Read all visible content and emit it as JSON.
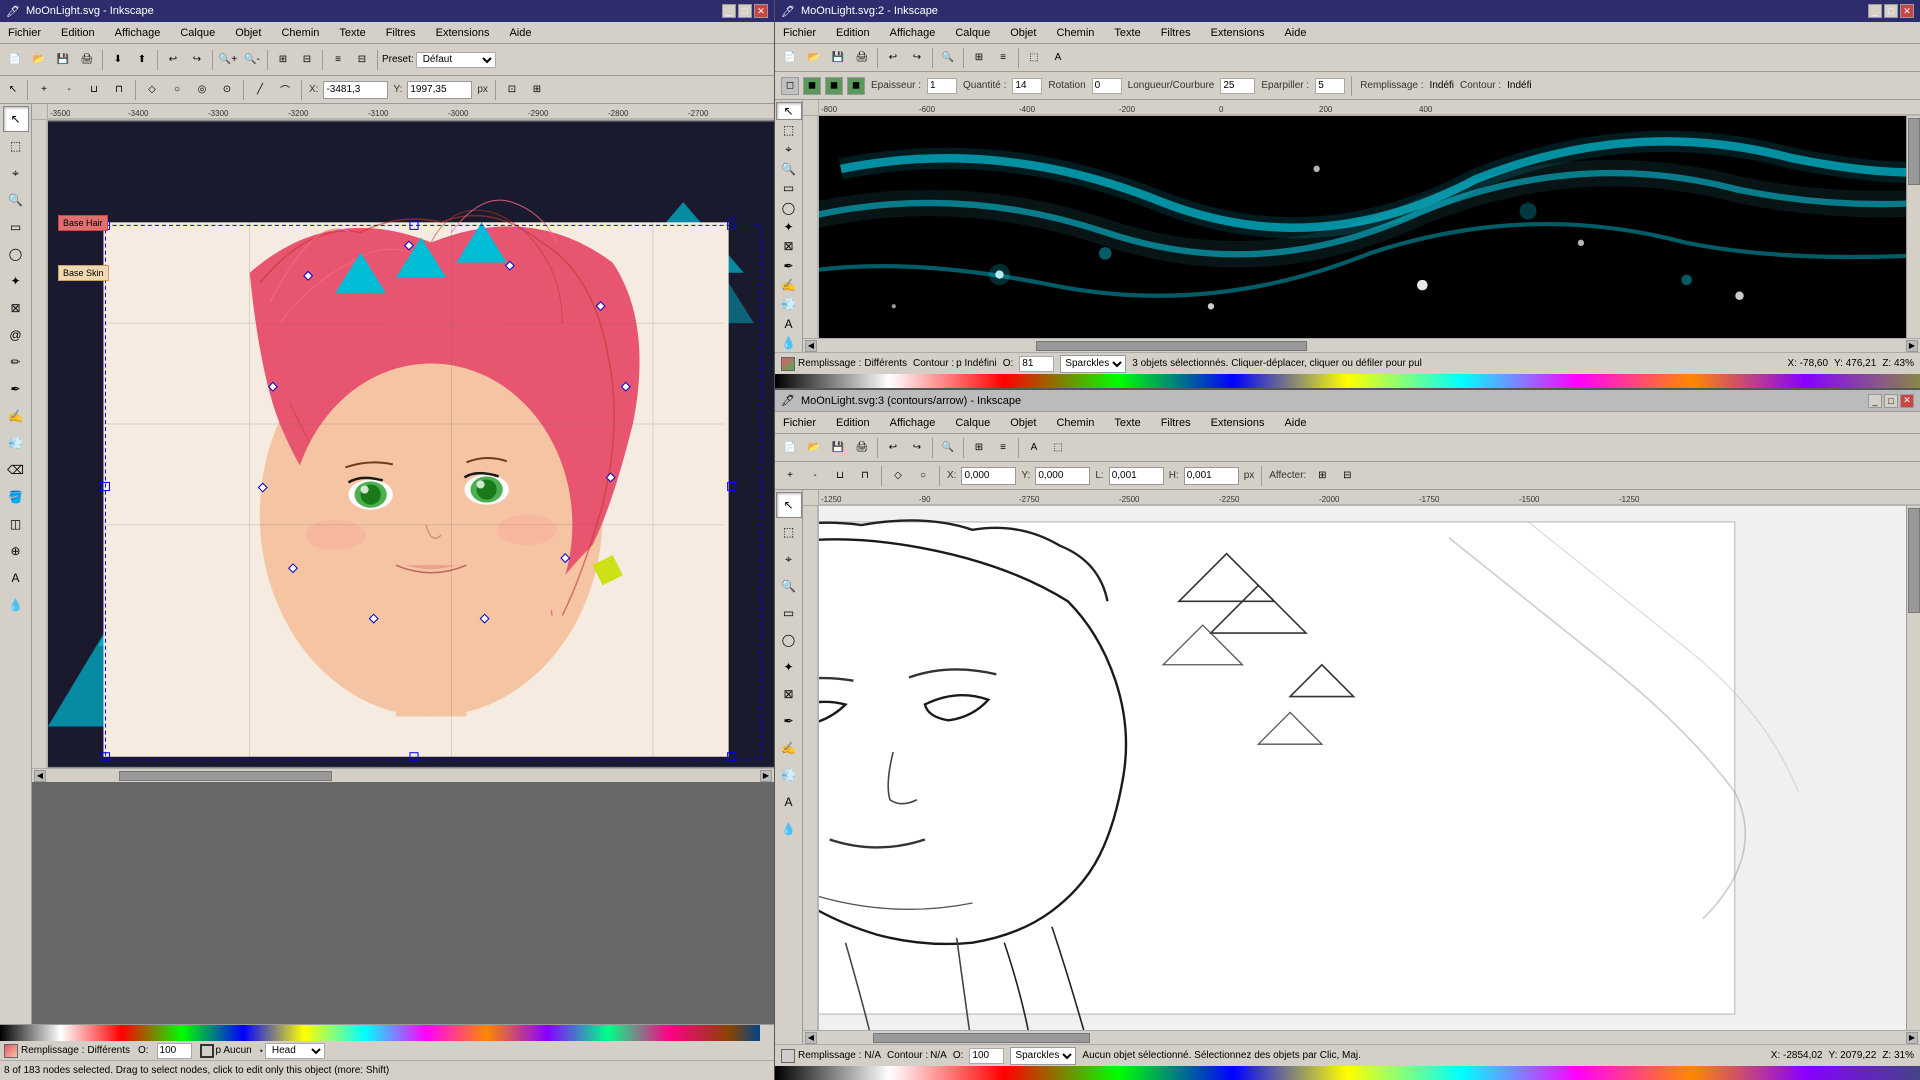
{
  "left_window": {
    "title": "MoOnLight.svg - Inkscape",
    "menu": [
      "Fichier",
      "Edition",
      "Affichage",
      "Calque",
      "Objet",
      "Chemin",
      "Texte",
      "Filtres",
      "Extensions",
      "Aide"
    ],
    "toolbar_preset": "Défaut",
    "node_toolbar": {
      "x_label": "X:",
      "x_value": "-3481,3",
      "y_label": "Y:",
      "y_value": "1997,35",
      "px_label": "px"
    },
    "tools": [
      "↖",
      "◻",
      "◯",
      "✏",
      "✒",
      "⌖",
      "✄",
      "📝",
      "🔍",
      "🎨",
      "💧",
      "📐",
      "⊕",
      "↕",
      "⊗"
    ],
    "layer_labels": [
      "Base Hair",
      "Base Skin"
    ],
    "status": {
      "fill_label": "Remplissage :",
      "fill_value": "Différents",
      "contour_label": "Contour :",
      "contour_value": "p Aucun",
      "opacity": "100",
      "brush": "Head",
      "message": "8 of 183 nodes selected. Drag to select nodes, click to edit only this object (more: Shift)"
    }
  },
  "right_top_window": {
    "title": "MoOnLight.svg:2 - Inkscape",
    "menu": [
      "Fichier",
      "Edition",
      "Affichage",
      "Calque",
      "Objet",
      "Chemin",
      "Texte",
      "Filtres",
      "Extensions",
      "Aide"
    ],
    "mode_bar": {
      "epaisseur_label": "Epaisseur :",
      "epaisseur_value": "1",
      "quantite_label": "Quantité :",
      "quantite_value": "14",
      "rotation_label": "Rotation",
      "rotation_value": "0",
      "longueur_label": "Longueur/Courbure",
      "longueur_value": "25",
      "eparpiller_label": "Eparpiller :",
      "eparpiller_value": "5",
      "remplissage_label": "Remplissage :",
      "remplissage_value": "Indéfi",
      "contour_label": "Contour :",
      "contour_value": "Indéfi"
    },
    "bottom_status": {
      "remplissage": "Différents",
      "contour": "p Indéfini",
      "opacity": "81",
      "brush": "Sparckles",
      "message": "3 objets sélectionnés. Cliquer-déplacer, cliquer ou défiler pour pul",
      "x": "X: -78,60",
      "y": "Y: 476,21",
      "zoom": "Z: 43%"
    }
  },
  "right_bottom_window": {
    "title": "MoOnLight.svg:3 (contours/arrow) - Inkscape",
    "menu": [
      "Fichier",
      "Edition",
      "Affichage",
      "Calque",
      "Objet",
      "Chemin",
      "Texte",
      "Filtres",
      "Extensions",
      "Aide"
    ],
    "node_toolbar": {
      "x_value": "0,000",
      "y_value": "0,000",
      "l_value": "0,001",
      "h_value": "0,001",
      "px_label": "px",
      "affecter_label": "Affecter:"
    },
    "bottom_status": {
      "remplissage": "N/A",
      "contour": "N/A",
      "opacity": "100",
      "brush": "Sparckles",
      "message": "Aucun objet sélectionné. Sélectionnez des objets par Clic, Maj.",
      "x": "X: -2854,02",
      "y": "Y: 2079,22",
      "zoom": "Z: 31%"
    }
  },
  "colors": {
    "title_bar_bg": "#2d2d6e",
    "menu_bg": "#d4d0c8",
    "toolbar_bg": "#d4d0c8",
    "canvas_bg": "#686868",
    "accent": "#316ac5"
  },
  "icons": {
    "arrow": "↖",
    "node": "⬚",
    "zoom": "🔍",
    "pen": "✒",
    "pencil": "✏",
    "rect": "▭",
    "circle": "◯",
    "star": "✦",
    "text": "A",
    "bucket": "🪣",
    "dropper": "💧",
    "gradient": "◫",
    "connector": "⊞",
    "spray": "💨",
    "measure": "📏"
  }
}
